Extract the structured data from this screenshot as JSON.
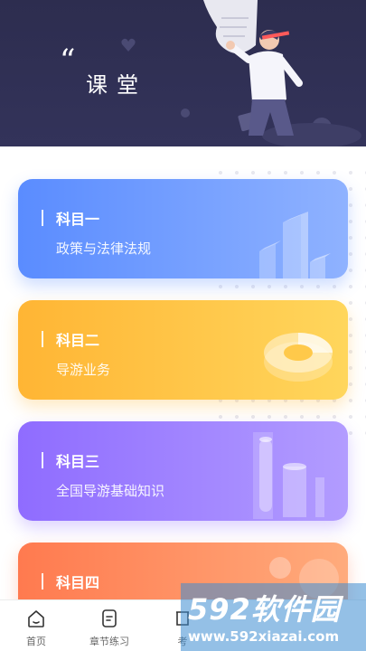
{
  "header": {
    "quote_mark": "“",
    "title": "课堂"
  },
  "subjects": [
    {
      "subject": "科目一",
      "course": "政策与法律法规"
    },
    {
      "subject": "科目二",
      "course": "导游业务"
    },
    {
      "subject": "科目三",
      "course": "全国导游基础知识"
    },
    {
      "subject": "科目四",
      "course": ""
    }
  ],
  "tabs": [
    {
      "label": "首页",
      "icon": "home-icon"
    },
    {
      "label": "章节练习",
      "icon": "chapter-practice-icon"
    },
    {
      "label": "考",
      "icon": "exam-icon"
    }
  ],
  "watermark": {
    "main": "592软件园",
    "url": "www.592xiazai.com"
  },
  "colors": {
    "banner": "#2d2d4f",
    "card1": "#5a8cff",
    "card2": "#ffb534",
    "card3": "#8f6cff",
    "card4": "#ff7a4f"
  }
}
